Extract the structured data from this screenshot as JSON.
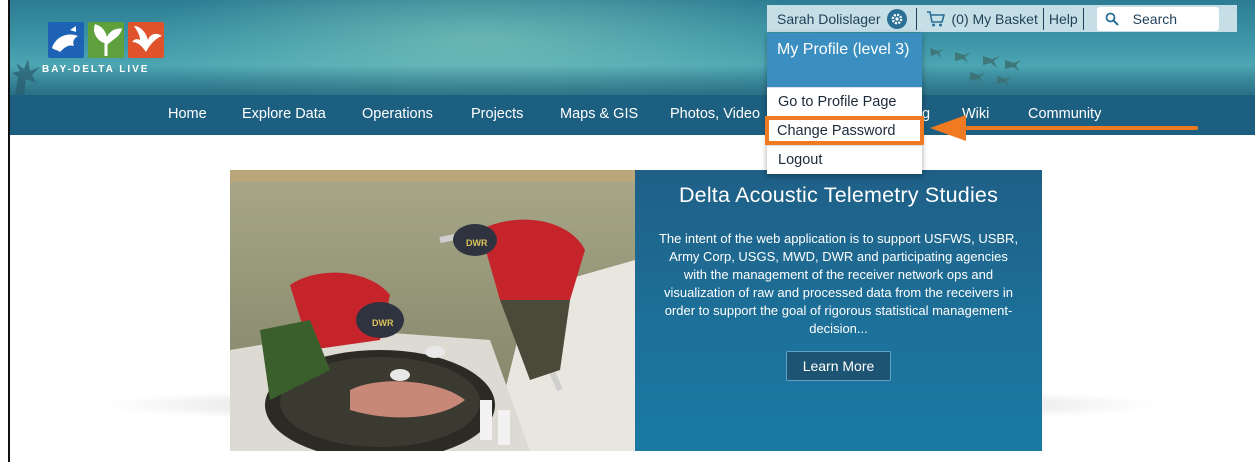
{
  "site": {
    "logo_text": "BAY-DELTA LIVE"
  },
  "utility": {
    "user_name": "Sarah Dolislager",
    "basket": "(0) My Basket",
    "help": "Help",
    "search_placeholder": "Search"
  },
  "nav": {
    "items": [
      {
        "label": "Home"
      },
      {
        "label": "Explore Data"
      },
      {
        "label": "Operations"
      },
      {
        "label": "Projects"
      },
      {
        "label": "Maps & GIS"
      },
      {
        "label": "Photos, Video"
      },
      {
        "label": "g"
      },
      {
        "label": "Wiki"
      },
      {
        "label": "Community"
      }
    ]
  },
  "profile_menu": {
    "header": "My Profile (level 3)",
    "items": [
      {
        "label": "Go to Profile Page"
      },
      {
        "label": "Change Password"
      },
      {
        "label": "Logout"
      }
    ],
    "highlighted_item": "Change Password"
  },
  "hero": {
    "title": "Delta Acoustic Telemetry Studies",
    "description": "The intent of the web application is to support USFWS, USBR, Army Corp, USGS, MWD, DWR and participating agencies with the management of the receiver network ops and visualization of raw and processed data from the receivers in order to support the goal of rigorous statistical management-decision...",
    "button": "Learn More",
    "photo_caps": [
      "DWR",
      "DWR"
    ]
  },
  "colors": {
    "nav_bg": "#1d5f80",
    "menu_header": "#3a8fc0",
    "highlight": "#f07a21",
    "panel_bg": "#1d6f98"
  }
}
